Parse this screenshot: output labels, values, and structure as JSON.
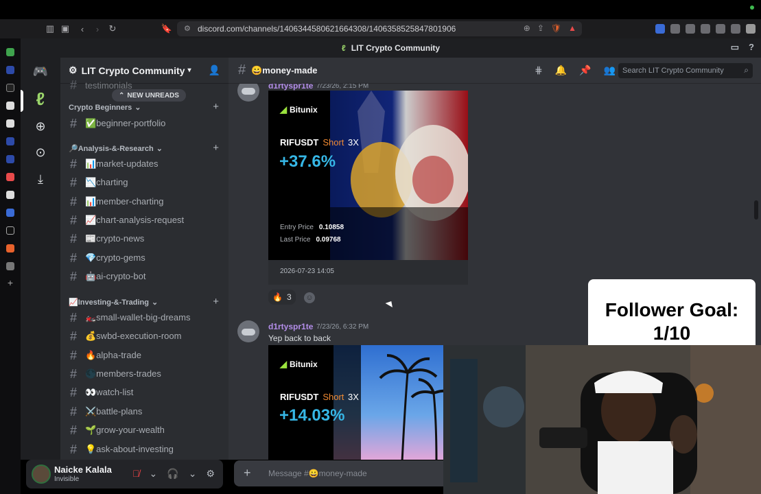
{
  "browser": {
    "url": "discord.com/channels/1406344580621664308/1406358525847801906"
  },
  "titlebar": {
    "title": "LIT Crypto Community"
  },
  "server": {
    "name": "LIT Crypto Community",
    "new_unreads": "NEW UNREADS"
  },
  "sidebar": {
    "partial_top_channel": "testimonials",
    "categories": [
      {
        "name": "Crypto Beginners",
        "channels": [
          "✅beginner-portfolio"
        ]
      },
      {
        "name": "🔎Analysis-&-Research",
        "channels": [
          "📊market-updates",
          "📉charting",
          "📊member-charting",
          "📈chart-analysis-request",
          "📰crypto-news",
          "💎crypto-gems",
          "🤖ai-crypto-bot"
        ]
      },
      {
        "name": "📈Investing-&-Trading",
        "channels": [
          "🏍️small-wallet-big-dreams",
          "💰swbd-execution-room",
          "🔥alpha-trade",
          "🌑members-trades",
          "👀watch-list",
          "⚔️battle-plans",
          "🌱grow-your-wealth",
          "💡ask-about-investing"
        ]
      }
    ]
  },
  "user": {
    "name": "Naicke Kalala",
    "status": "Invisible"
  },
  "chat": {
    "channel_name": "😀money-made",
    "search_placeholder": "Search LIT Crypto Community",
    "composer_placeholder": "Message #😀money-made",
    "messages": [
      {
        "author": "d1rtyspr1te",
        "time": "7/23/26, 2:15 PM",
        "card": {
          "brand": "Bitunix",
          "pair": "RIFUSDT",
          "side": "Short",
          "leverage": "3X",
          "pnl": "+37.6%",
          "entry_label": "Entry Price",
          "entry_value": "0.10858",
          "last_label": "Last Price",
          "last_value": "0.09768"
        },
        "footer_time": "2026-07-23 14:05",
        "reaction": {
          "emoji": "🔥",
          "count": "3"
        }
      },
      {
        "author": "d1rtyspr1te",
        "time": "7/23/26, 6:32 PM",
        "text": "Yep back to back",
        "card": {
          "brand": "Bitunix",
          "pair": "RIFUSDT",
          "side": "Short",
          "leverage": "3X",
          "pnl": "+14.03%"
        }
      }
    ]
  },
  "overlay": {
    "goal_line1": "Follower Goal:",
    "goal_line2": "1/10"
  },
  "colors": {
    "accent_green": "#9be33e",
    "short_orange": "#f08a33",
    "pnl_blue": "#36b7e6",
    "username_purple": "#b48eea"
  }
}
